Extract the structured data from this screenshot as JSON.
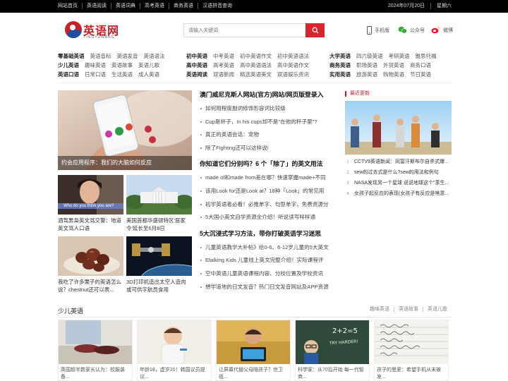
{
  "topbar": {
    "links": [
      "网站首页",
      "英语阅读",
      "英语词典",
      "高考英语",
      "商务英语",
      "汉语拼音查询"
    ],
    "date": "2024年07月20日",
    "weekday": "星期六"
  },
  "logo": {
    "name": "英语网",
    "sub": "YINGYUWANG"
  },
  "search": {
    "placeholder": "请输入关键词"
  },
  "quick": [
    {
      "label": "手机版",
      "icon": "phone-icon"
    },
    {
      "label": "公众号",
      "icon": "wechat-icon"
    },
    {
      "label": "微博",
      "icon": "weibo-icon"
    }
  ],
  "nav": {
    "group1": [
      {
        "head": "零基础英语",
        "items": [
          "英语音标",
          "英语发音",
          "英语语法"
        ]
      },
      {
        "head": "少儿英语",
        "items": [
          "趣味英语",
          "英语故事",
          "英语儿歌"
        ]
      },
      {
        "head": "英语口语",
        "items": [
          "日常口语",
          "生活英语",
          "成人英语"
        ]
      }
    ],
    "group2": [
      {
        "head": "初中英语",
        "items": [
          "中考英语",
          "初中英语作文",
          "初中英语语法"
        ]
      },
      {
        "head": "高中英语",
        "items": [
          "高考英语",
          "高中英语语法",
          "高中英语作文"
        ]
      },
      {
        "head": "英语阅读",
        "items": [
          "双语新闻",
          "精选英语美文",
          "双语娱乐资讯"
        ]
      }
    ],
    "group3": [
      {
        "head": "大学英语",
        "items": [
          "四六级英语",
          "考研英语",
          "雅思托福"
        ]
      },
      {
        "head": "商务英语",
        "items": [
          "职场英语",
          "外贸英语",
          "商务口语"
        ]
      },
      {
        "head": "实用英语",
        "items": [
          "旅游英语",
          "购物英语",
          "节日英语"
        ]
      }
    ]
  },
  "feature": {
    "caption": "约会应用程序：我们的大脑如何反应"
  },
  "thumbs": [
    {
      "title": "酒驾男枭英文骂交警：地道英文骂人口语",
      "overlay": "Who do you think you are?"
    },
    {
      "title": "美国首都华盛顿特区'居家令'延长至6月8日"
    },
    {
      "title": "我吃了许多栗子的英语怎么说？chestnut还可以表..."
    },
    {
      "title": "3D打印机造出太空人造肉 或可供宇航员食用"
    }
  ],
  "middle": [
    {
      "head": "澳门威尼克斯人网站(官方)网站/网页版登录入",
      "items": [
        "如何用程度副词修饰形容词比较级",
        "Cup是杯子，In his cups却不是\"在他的杯子里\"?",
        "真正的英语会话：宠物",
        "除了Fighting还可以这样说!"
      ]
    },
    {
      "head": "你知道它们分别吗？6 个「除了」的英文用法",
      "items": [
        "made of和made from差在哪？快速掌握made+不同",
        "该用Look for还是Look at？18种「Look」的常见用",
        "初学英语者必看！必推单字、句型单字、免费资源分",
        "5大国小英文自学资源全介绍！听说读写样样通"
      ]
    },
    {
      "head": "5大沉浸式学习方法，带你打破英语学习迷思",
      "items": [
        "儿童英语教学大补帖》给0-6、6-12岁儿童的5大英文",
        "Etalking Kids 儿童线上英文完整介绍！实际课程评",
        "空中英语儿童英语课程内容、分校位置及学校资讯",
        "想学道地的日文发音？热门日文发音网站及APP资源"
      ]
    }
  ],
  "recent": {
    "title": "最近更新",
    "items": [
      "CCTV9英语新闻：同富汗斯布尔自杀式爆...",
      "sew的过去式是什么?sew的用法和例句",
      "NASA发现另一个星球 说说地球这个\"孪生...",
      "女孩子起反应的表现(女孩子有反应是啥意..."
    ]
  },
  "section": {
    "title": "少儿英语",
    "tabs": [
      "趣味英语",
      "英语故事",
      "英语儿歌"
    ],
    "cards": [
      "英国超半数家长认为：校服装备...",
      "年龄18，虚岁20！韩国议员提议...",
      "让屏幕代替父母陪孩子？世卫组...",
      "科学家：从70后开始 每一代智商...",
      "孩子的思爱：希望手机从未被发..."
    ],
    "chalk": [
      "2+2=5",
      "TRY HARDER!"
    ]
  },
  "colors": {
    "accent": "#d8252b",
    "topbar": "#000000"
  }
}
